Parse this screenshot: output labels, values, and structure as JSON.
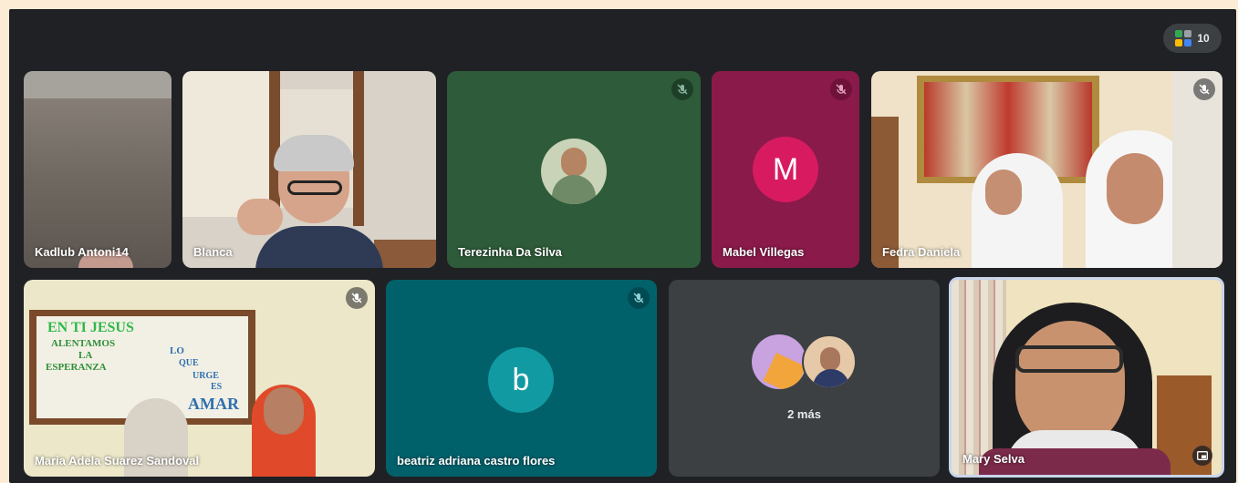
{
  "meeting": {
    "participant_count": "10",
    "people_icon": "people-grid-icon"
  },
  "tiles": {
    "kadlub": {
      "name": "Kadlub Antoni14"
    },
    "blanca": {
      "name": "Blanca"
    },
    "terezinha": {
      "name": "Terezinha Da Silva",
      "muted": true
    },
    "mabel": {
      "name": "Mabel Villegas",
      "initial": "M",
      "muted": true
    },
    "fedra": {
      "name": "Fedra Daniela",
      "muted": true
    },
    "maria": {
      "name": "Maria Adela Suarez Sandoval",
      "muted": true,
      "poster": [
        "EN TI JESUS",
        "ALENTAMOS",
        "LA",
        "ESPERANZA",
        "LO",
        "QUE",
        "URGE",
        "ES",
        "AMAR"
      ]
    },
    "beatriz": {
      "name": "beatriz adriana castro flores",
      "initial": "b",
      "muted": true
    },
    "more": {
      "label": "2 más"
    },
    "mary": {
      "name": "Mary Selva"
    }
  },
  "colors": {
    "screen": "#202124",
    "terezinha_bg": "#2e5b3a",
    "mabel_bg": "#8a1a4a",
    "mabel_avatar": "#d81b60",
    "beatriz_bg": "#00616b",
    "beatriz_avatar": "#129aa3",
    "more_bg": "#3c4043"
  }
}
